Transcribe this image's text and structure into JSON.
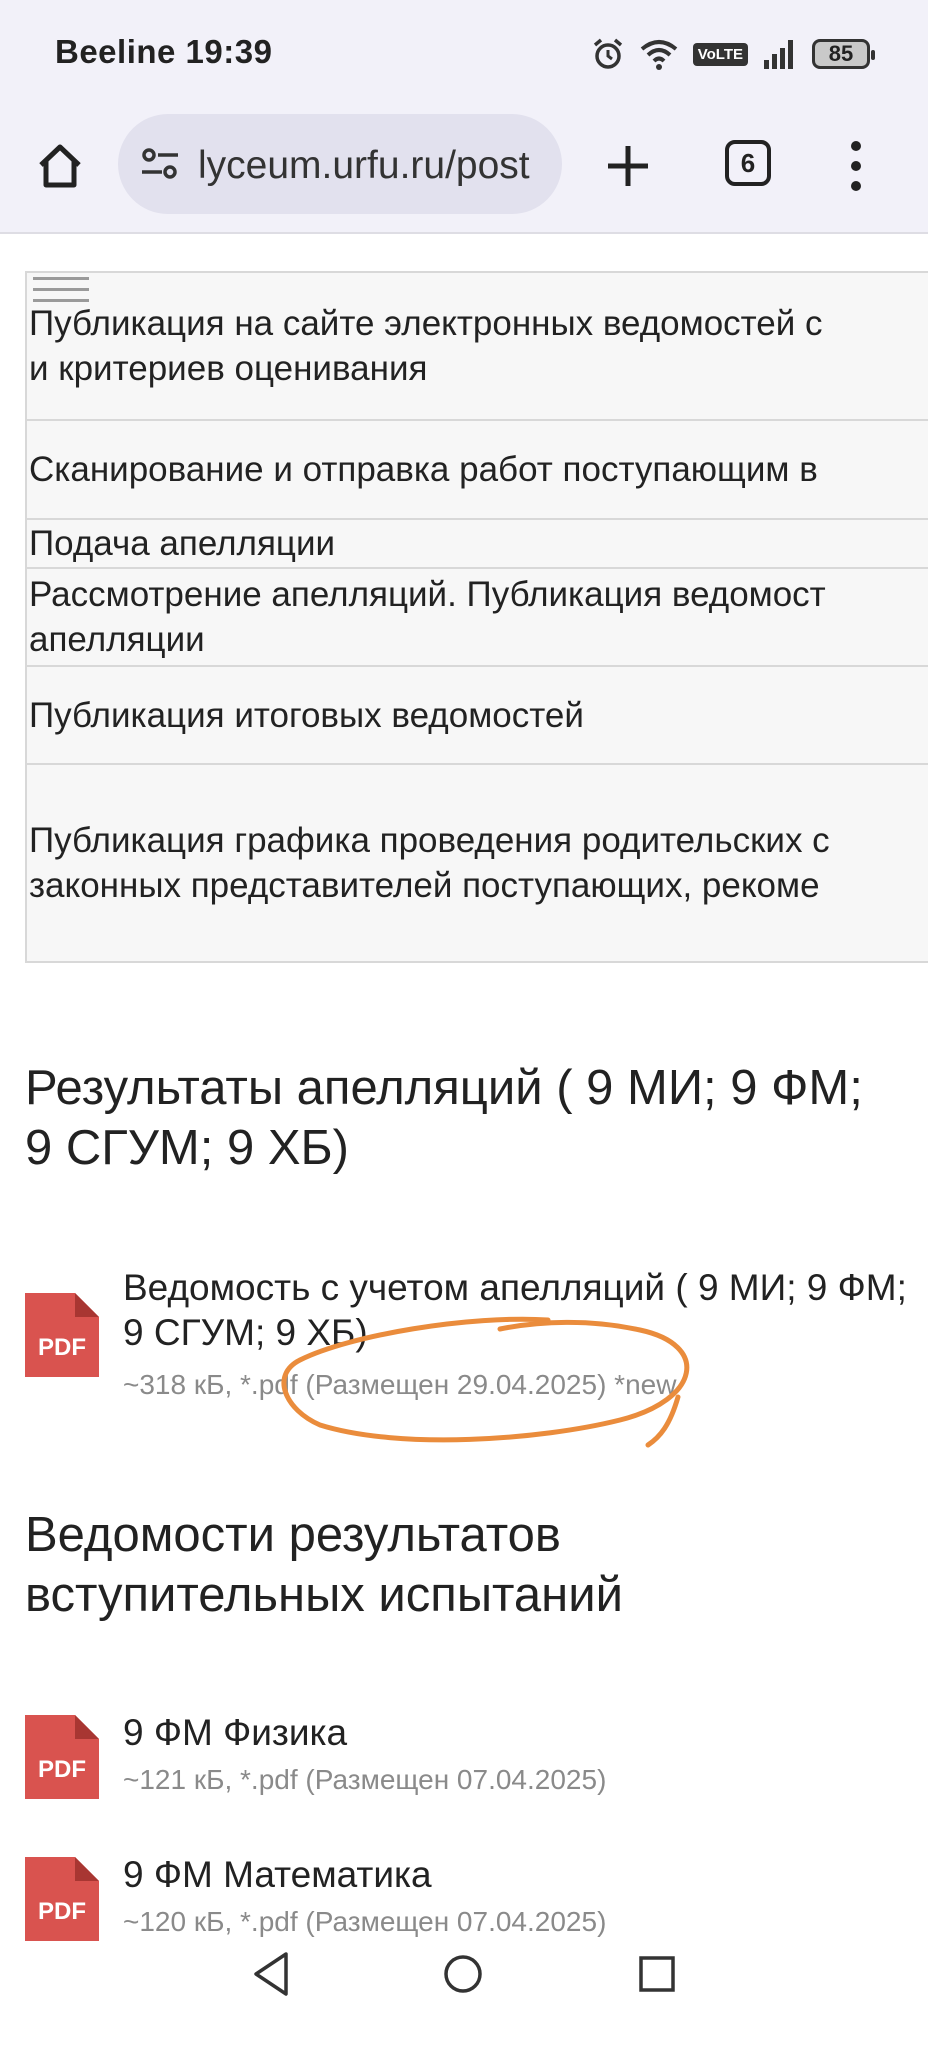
{
  "status_bar": {
    "carrier_time": "Beeline 19:39",
    "volte": "VoLTE",
    "battery": "85"
  },
  "browser": {
    "url": "lyceum.urfu.ru/post",
    "tab_count": "6"
  },
  "schedule_rows": [
    {
      "text": "Публикация на сайте электронных ведомостей с\nи критериев оценивания"
    },
    {
      "text": "Сканирование и отправка работ поступающим в"
    },
    {
      "text": "Подача апелляции"
    },
    {
      "text": "Рассмотрение апелляций. Публикация ведомост\nапелляции"
    },
    {
      "text": "Публикация итоговых ведомостей"
    },
    {
      "text": "Публикация графика проведения родительских с\nзаконных представителей поступающих, рекоме"
    }
  ],
  "section_appeals": {
    "title": "Результаты апелляций ( 9 МИ; 9 ФМ; 9 СГУМ; 9 ХБ)",
    "files": [
      {
        "icon_label": "PDF",
        "name": "Ведомость с учетом апелляций ( 9 МИ; 9 ФМ; 9 СГУМ; 9 ХБ)",
        "meta": "~318 кБ, *.pdf (Размещен 29.04.2025) *new"
      }
    ]
  },
  "section_results": {
    "title": "Ведомости результатов вступительных испытаний",
    "files": [
      {
        "icon_label": "PDF",
        "name": "9 ФМ Физика",
        "meta": "~121 кБ, *.pdf (Размещен 07.04.2025)"
      },
      {
        "icon_label": "PDF",
        "name": "9 ФМ Математика",
        "meta": "~120 кБ, *.pdf (Размещен 07.04.2025)"
      }
    ]
  },
  "colors": {
    "pdf_red": "#d9534f",
    "annotation_orange": "#ea8c3c",
    "chrome_bg": "#f2f1f9",
    "urlbar_bg": "#e2e1ee"
  },
  "icons": [
    "alarm-icon",
    "wifi-icon",
    "signal-icon",
    "battery-icon",
    "home-icon",
    "site-settings-icon",
    "new-tab-icon",
    "tab-switcher-icon",
    "more-menu-icon",
    "hamburger-icon",
    "pdf-icon",
    "back-nav-icon",
    "home-nav-icon",
    "recents-nav-icon"
  ]
}
